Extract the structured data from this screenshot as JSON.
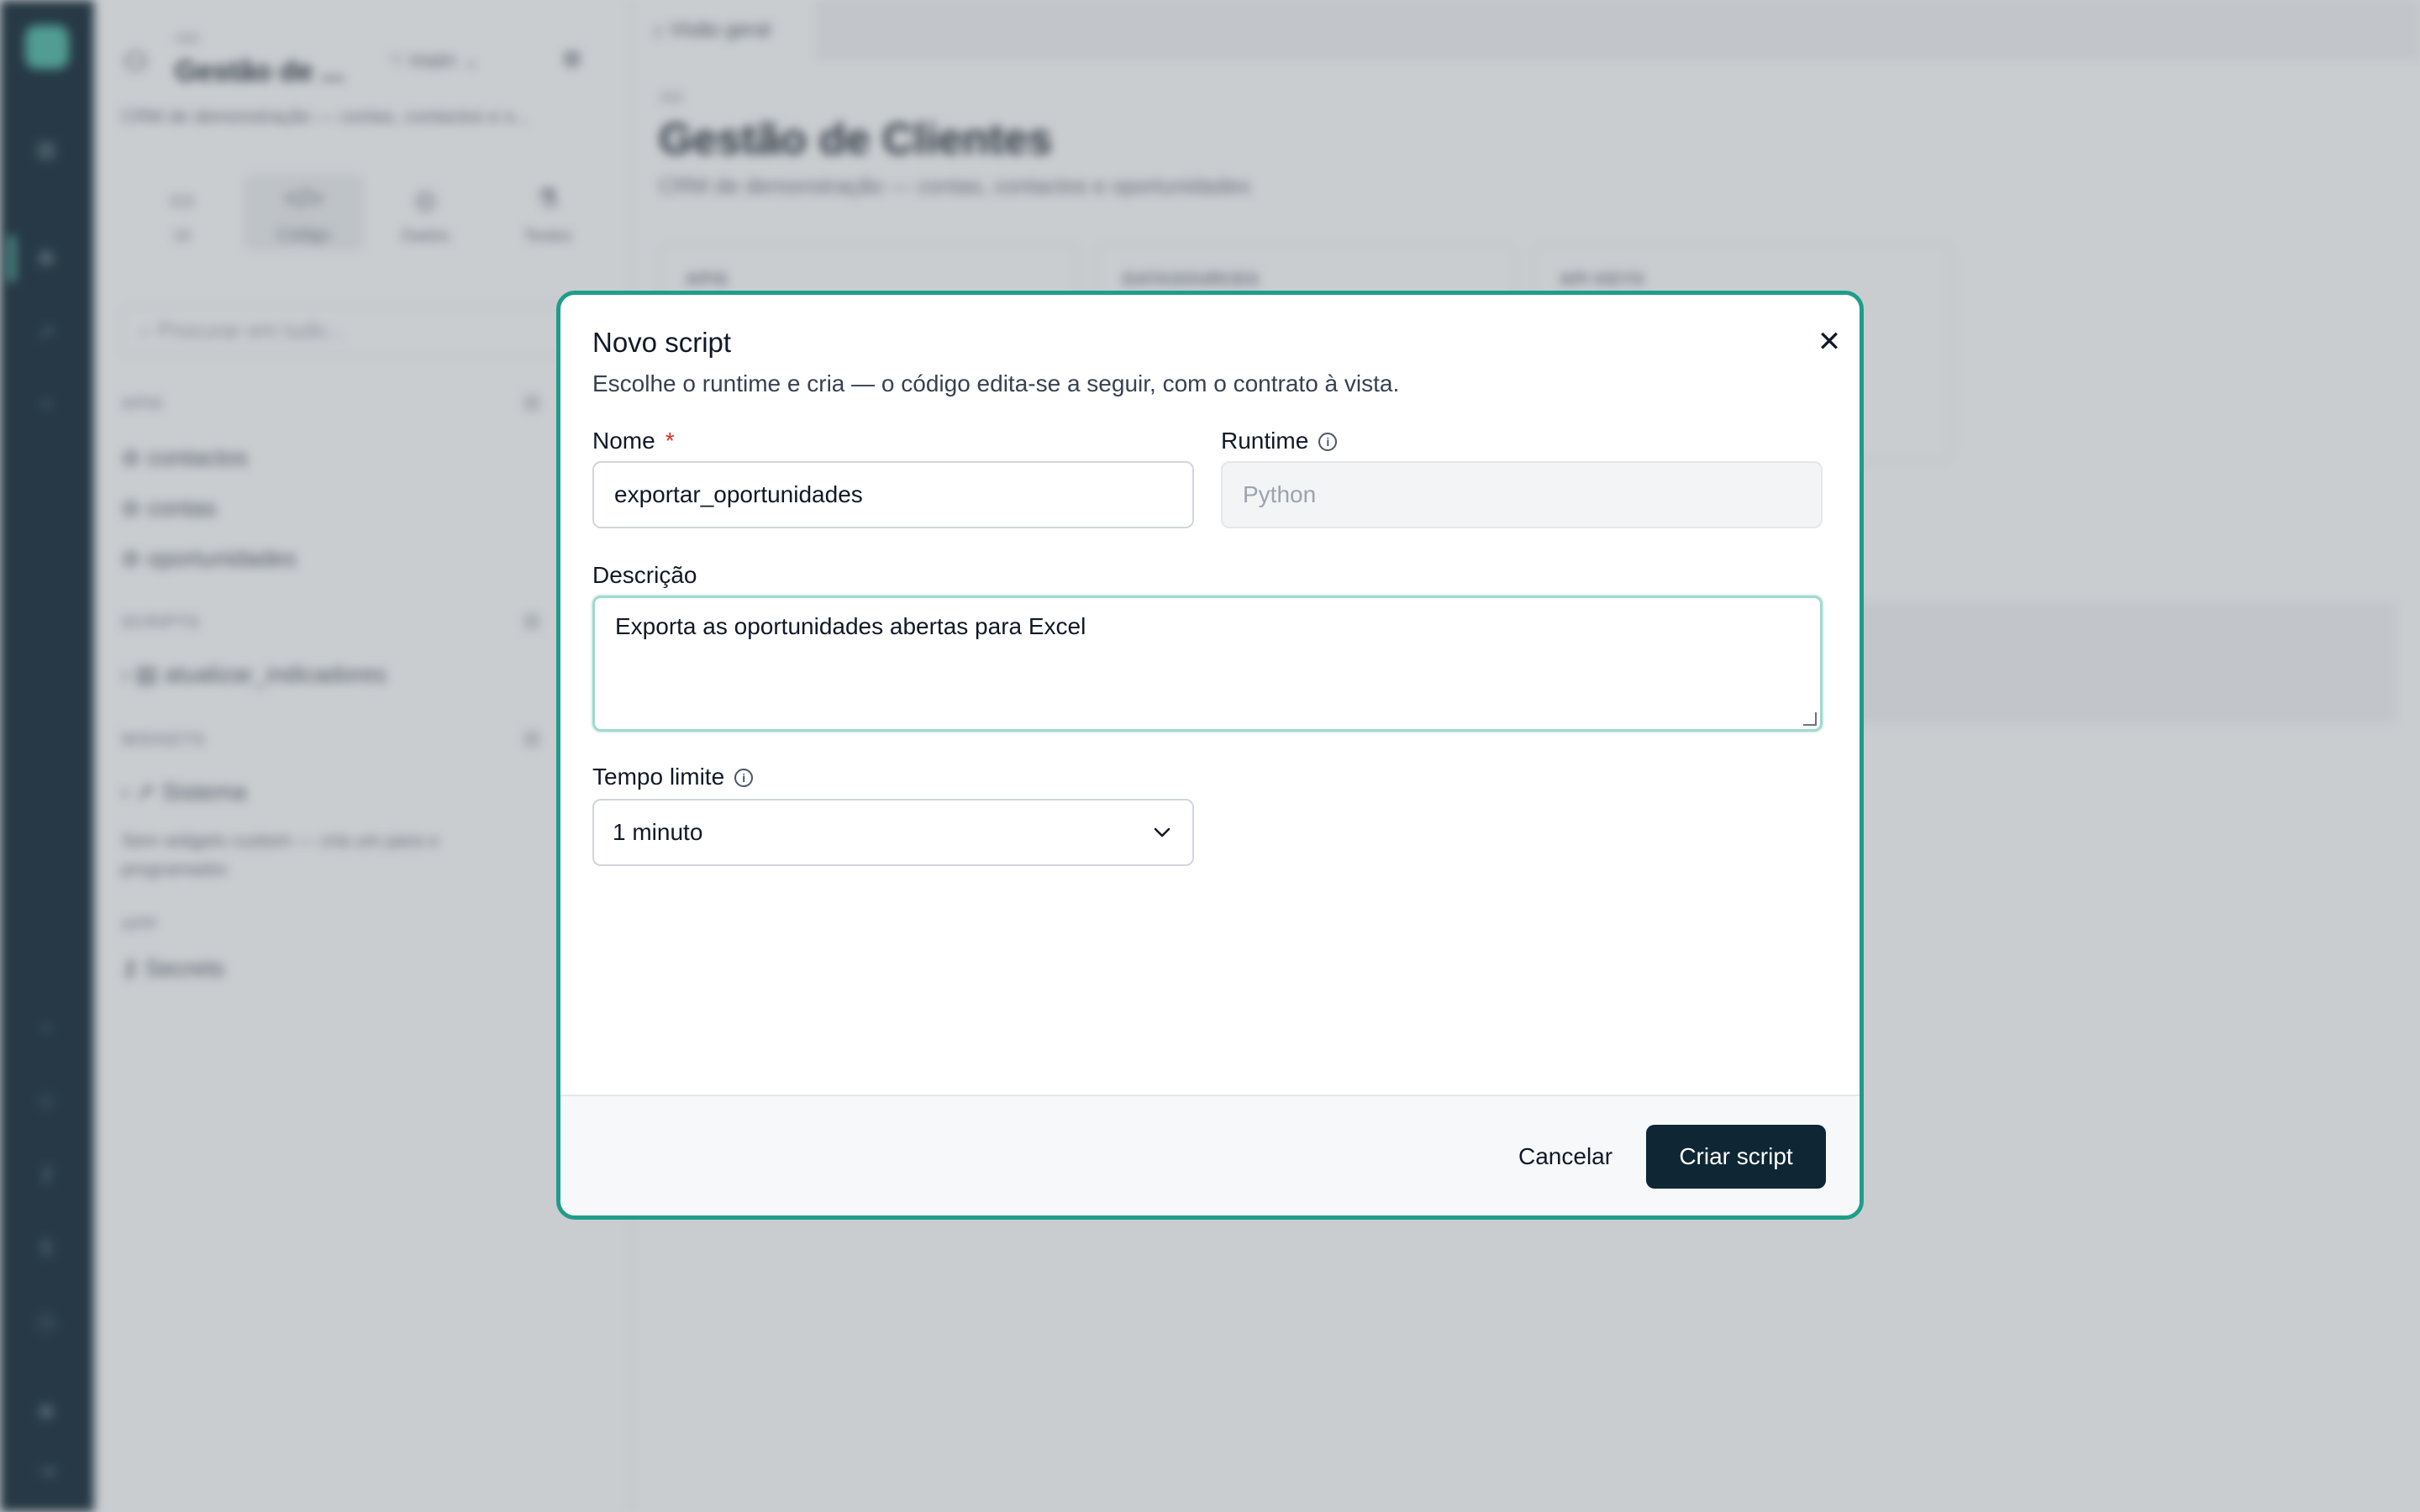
{
  "background": {
    "sidebar": {
      "app_small": "app",
      "project_title": "Gestão de ...",
      "branch": "main",
      "project_desc": "CRM de demonstração — contas, contactos e o...",
      "tabs": [
        "UI",
        "Código",
        "Dados",
        "Testes"
      ],
      "search_placeholder": "Procurar em tudo...",
      "sections": {
        "apis": "APIS",
        "scripts": "SCRIPTS",
        "widgets": "WIDGETS",
        "app": "APP"
      },
      "apis": [
        "contactos",
        "contas",
        "oportunidades"
      ],
      "scripts": [
        "atualizar_indicadores"
      ],
      "widgets_group": "Sistema",
      "widgets_note": "Sem widgets custom — cria um para o programador.",
      "app_items": [
        "Secrets"
      ]
    },
    "main": {
      "tab": "Visão geral",
      "app_small": "app",
      "title": "Gestão de Clientes",
      "desc": "CRM de demonstração — contas, contactos e oportunidades",
      "cards": [
        "APIS",
        "DATASOURCES",
        "API KEYS"
      ]
    }
  },
  "modal": {
    "title": "Novo script",
    "subtitle": "Escolhe o runtime e cria — o código edita-se a seguir, com o contrato à vista.",
    "name_label": "Nome",
    "required_mark": "*",
    "name_value": "exportar_oportunidades",
    "runtime_label": "Runtime",
    "runtime_value": "Python",
    "description_label": "Descrição",
    "description_value": "Exporta as oportunidades abertas para Excel",
    "timeout_label": "Tempo limite",
    "timeout_value": "1 minuto",
    "cancel_label": "Cancelar",
    "create_label": "Criar script"
  },
  "colors": {
    "accent": "#1f9d8a",
    "primary_button": "#0f2634",
    "required": "#d92d20"
  }
}
